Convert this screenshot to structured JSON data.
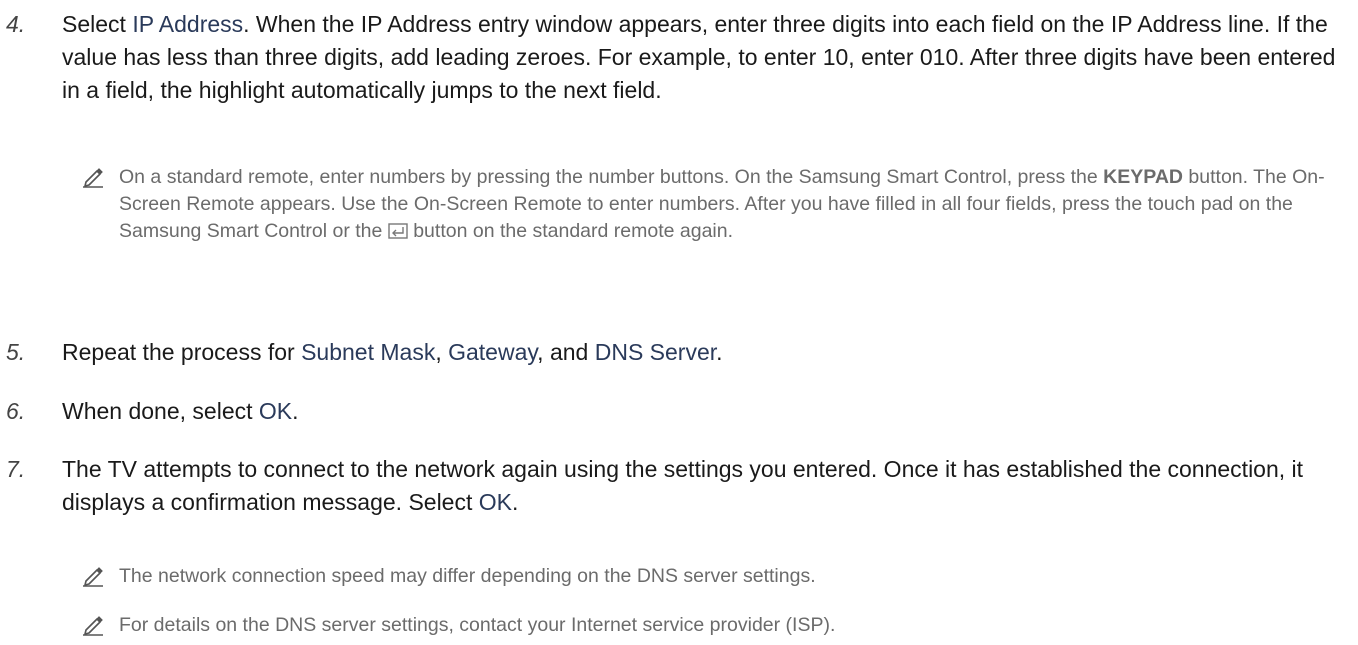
{
  "steps": [
    {
      "num": "4.",
      "parts": [
        {
          "t": "Select "
        },
        {
          "t": "IP Address",
          "hl": true
        },
        {
          "t": ". When the IP Address entry window appears, enter three digits into each field on the IP Address line. If the value has less than three digits, add leading zeroes. For example, to enter 10, enter 010. After three digits have been entered in a field, the highlight automatically jumps to the next field."
        }
      ]
    },
    {
      "num": "5.",
      "parts": [
        {
          "t": "Repeat the process for "
        },
        {
          "t": "Subnet Mask",
          "hl": true
        },
        {
          "t": ", "
        },
        {
          "t": "Gateway",
          "hl": true
        },
        {
          "t": ", and "
        },
        {
          "t": "DNS Server",
          "hl": true
        },
        {
          "t": "."
        }
      ]
    },
    {
      "num": "6.",
      "parts": [
        {
          "t": "When done, select "
        },
        {
          "t": "OK",
          "hl": true
        },
        {
          "t": "."
        }
      ]
    },
    {
      "num": "7.",
      "parts": [
        {
          "t": "The TV attempts to connect to the network again using the settings you entered. Once it has established the connection, it displays a confirmation message. Select "
        },
        {
          "t": "OK",
          "hl": true
        },
        {
          "t": "."
        }
      ]
    }
  ],
  "notes": [
    {
      "parts": [
        {
          "t": "On a standard remote, enter numbers by pressing the number buttons. On the Samsung Smart Control, press the "
        },
        {
          "t": "KEYPAD",
          "bold": true
        },
        {
          "t": " button. The On-Screen Remote appears. Use the On-Screen Remote to enter numbers. After you have filled in all four fields, press the touch pad on the Samsung Smart Control or the "
        },
        {
          "icon": "enter-button-icon"
        },
        {
          "t": " button on the standard remote again."
        }
      ]
    },
    {
      "parts": [
        {
          "t": "The network connection speed may differ depending on the DNS server settings."
        }
      ]
    },
    {
      "parts": [
        {
          "t": "For details on the DNS server settings, contact your Internet service provider (ISP)."
        }
      ]
    }
  ],
  "icons": {
    "note": "pencil-note-icon",
    "enter": "enter-button-icon"
  },
  "colors": {
    "body_text": "#1a1a1a",
    "highlight_text": "#2a3a5a",
    "note_text": "#6b6b6b",
    "step_number": "#444444"
  }
}
